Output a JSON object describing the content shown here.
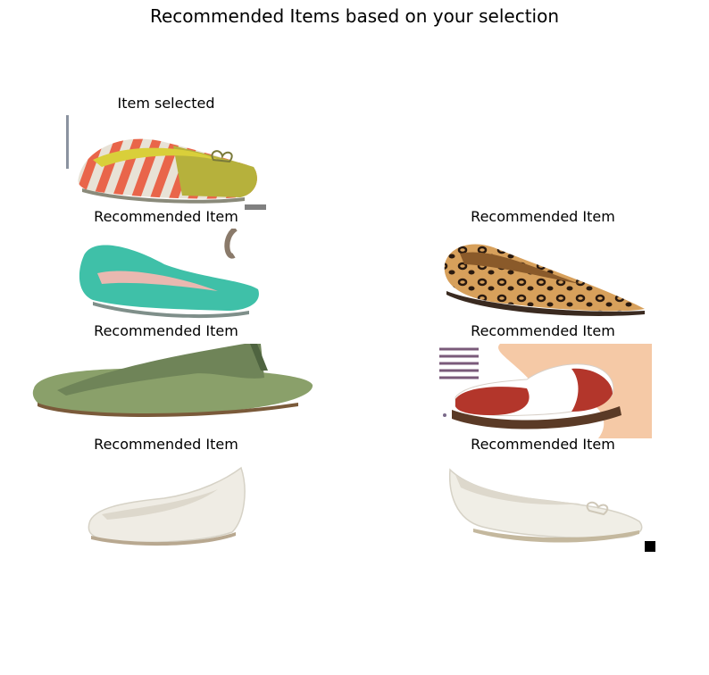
{
  "page": {
    "title": "Recommended Items based on your selection"
  },
  "selected": {
    "label": "Item selected"
  },
  "recommendations": [
    {
      "label": "Recommended Item"
    },
    {
      "label": "Recommended Item"
    },
    {
      "label": "Recommended Item"
    },
    {
      "label": "Recommended Item"
    },
    {
      "label": "Recommended Item"
    },
    {
      "label": "Recommended Item"
    }
  ]
}
